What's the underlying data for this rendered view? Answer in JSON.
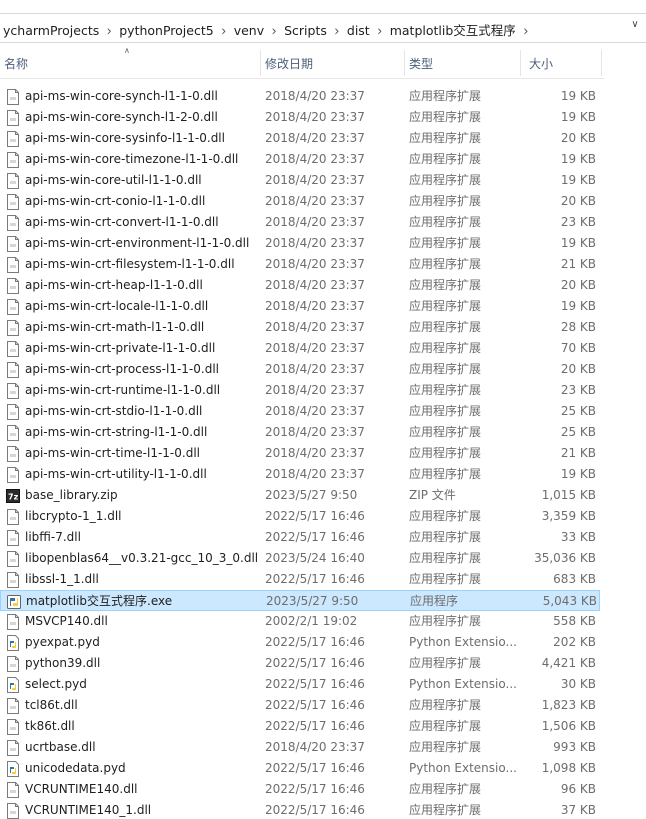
{
  "breadcrumb": [
    "ycharmProjects",
    "pythonProject5",
    "venv",
    "Scripts",
    "dist",
    "matplotlib交互式程序"
  ],
  "header": {
    "name": "名称",
    "date": "修改日期",
    "type": "类型",
    "size": "大小"
  },
  "rows": [
    {
      "name": "api-ms-win-core-synch-l1-1-0.dll",
      "date": "2018/4/20 23:37",
      "type": "应用程序扩展",
      "size": "19 KB",
      "icon": "dll-icon"
    },
    {
      "name": "api-ms-win-core-synch-l1-2-0.dll",
      "date": "2018/4/20 23:37",
      "type": "应用程序扩展",
      "size": "19 KB",
      "icon": "dll-icon"
    },
    {
      "name": "api-ms-win-core-sysinfo-l1-1-0.dll",
      "date": "2018/4/20 23:37",
      "type": "应用程序扩展",
      "size": "20 KB",
      "icon": "dll-icon"
    },
    {
      "name": "api-ms-win-core-timezone-l1-1-0.dll",
      "date": "2018/4/20 23:37",
      "type": "应用程序扩展",
      "size": "19 KB",
      "icon": "dll-icon"
    },
    {
      "name": "api-ms-win-core-util-l1-1-0.dll",
      "date": "2018/4/20 23:37",
      "type": "应用程序扩展",
      "size": "19 KB",
      "icon": "dll-icon"
    },
    {
      "name": "api-ms-win-crt-conio-l1-1-0.dll",
      "date": "2018/4/20 23:37",
      "type": "应用程序扩展",
      "size": "20 KB",
      "icon": "dll-icon"
    },
    {
      "name": "api-ms-win-crt-convert-l1-1-0.dll",
      "date": "2018/4/20 23:37",
      "type": "应用程序扩展",
      "size": "23 KB",
      "icon": "dll-icon"
    },
    {
      "name": "api-ms-win-crt-environment-l1-1-0.dll",
      "date": "2018/4/20 23:37",
      "type": "应用程序扩展",
      "size": "19 KB",
      "icon": "dll-icon"
    },
    {
      "name": "api-ms-win-crt-filesystem-l1-1-0.dll",
      "date": "2018/4/20 23:37",
      "type": "应用程序扩展",
      "size": "21 KB",
      "icon": "dll-icon"
    },
    {
      "name": "api-ms-win-crt-heap-l1-1-0.dll",
      "date": "2018/4/20 23:37",
      "type": "应用程序扩展",
      "size": "20 KB",
      "icon": "dll-icon"
    },
    {
      "name": "api-ms-win-crt-locale-l1-1-0.dll",
      "date": "2018/4/20 23:37",
      "type": "应用程序扩展",
      "size": "19 KB",
      "icon": "dll-icon"
    },
    {
      "name": "api-ms-win-crt-math-l1-1-0.dll",
      "date": "2018/4/20 23:37",
      "type": "应用程序扩展",
      "size": "28 KB",
      "icon": "dll-icon"
    },
    {
      "name": "api-ms-win-crt-private-l1-1-0.dll",
      "date": "2018/4/20 23:37",
      "type": "应用程序扩展",
      "size": "70 KB",
      "icon": "dll-icon"
    },
    {
      "name": "api-ms-win-crt-process-l1-1-0.dll",
      "date": "2018/4/20 23:37",
      "type": "应用程序扩展",
      "size": "20 KB",
      "icon": "dll-icon"
    },
    {
      "name": "api-ms-win-crt-runtime-l1-1-0.dll",
      "date": "2018/4/20 23:37",
      "type": "应用程序扩展",
      "size": "23 KB",
      "icon": "dll-icon"
    },
    {
      "name": "api-ms-win-crt-stdio-l1-1-0.dll",
      "date": "2018/4/20 23:37",
      "type": "应用程序扩展",
      "size": "25 KB",
      "icon": "dll-icon"
    },
    {
      "name": "api-ms-win-crt-string-l1-1-0.dll",
      "date": "2018/4/20 23:37",
      "type": "应用程序扩展",
      "size": "25 KB",
      "icon": "dll-icon"
    },
    {
      "name": "api-ms-win-crt-time-l1-1-0.dll",
      "date": "2018/4/20 23:37",
      "type": "应用程序扩展",
      "size": "21 KB",
      "icon": "dll-icon"
    },
    {
      "name": "api-ms-win-crt-utility-l1-1-0.dll",
      "date": "2018/4/20 23:37",
      "type": "应用程序扩展",
      "size": "19 KB",
      "icon": "dll-icon"
    },
    {
      "name": "base_library.zip",
      "date": "2023/5/27 9:50",
      "type": "ZIP 文件",
      "size": "1,015 KB",
      "icon": "zip-icon"
    },
    {
      "name": "libcrypto-1_1.dll",
      "date": "2022/5/17 16:46",
      "type": "应用程序扩展",
      "size": "3,359 KB",
      "icon": "dll-icon"
    },
    {
      "name": "libffi-7.dll",
      "date": "2022/5/17 16:46",
      "type": "应用程序扩展",
      "size": "33 KB",
      "icon": "dll-icon"
    },
    {
      "name": "libopenblas64__v0.3.21-gcc_10_3_0.dll",
      "date": "2023/5/24 16:40",
      "type": "应用程序扩展",
      "size": "35,036 KB",
      "icon": "dll-icon"
    },
    {
      "name": "libssl-1_1.dll",
      "date": "2022/5/17 16:46",
      "type": "应用程序扩展",
      "size": "683 KB",
      "icon": "dll-icon"
    },
    {
      "name": "matplotlib交互式程序.exe",
      "date": "2023/5/27 9:50",
      "type": "应用程序",
      "size": "5,043 KB",
      "icon": "python-exe-icon",
      "selected": true
    },
    {
      "name": "MSVCP140.dll",
      "date": "2002/2/1 19:02",
      "type": "应用程序扩展",
      "size": "558 KB",
      "icon": "dll-icon"
    },
    {
      "name": "pyexpat.pyd",
      "date": "2022/5/17 16:46",
      "type": "Python Extensio...",
      "size": "202 KB",
      "icon": "pyd-icon"
    },
    {
      "name": "python39.dll",
      "date": "2022/5/17 16:46",
      "type": "应用程序扩展",
      "size": "4,421 KB",
      "icon": "dll-icon"
    },
    {
      "name": "select.pyd",
      "date": "2022/5/17 16:46",
      "type": "Python Extensio...",
      "size": "30 KB",
      "icon": "pyd-icon"
    },
    {
      "name": "tcl86t.dll",
      "date": "2022/5/17 16:46",
      "type": "应用程序扩展",
      "size": "1,823 KB",
      "icon": "dll-icon"
    },
    {
      "name": "tk86t.dll",
      "date": "2022/5/17 16:46",
      "type": "应用程序扩展",
      "size": "1,506 KB",
      "icon": "dll-icon"
    },
    {
      "name": "ucrtbase.dll",
      "date": "2018/4/20 23:37",
      "type": "应用程序扩展",
      "size": "993 KB",
      "icon": "dll-icon"
    },
    {
      "name": "unicodedata.pyd",
      "date": "2022/5/17 16:46",
      "type": "Python Extensio...",
      "size": "1,098 KB",
      "icon": "pyd-icon"
    },
    {
      "name": "VCRUNTIME140.dll",
      "date": "2022/5/17 16:46",
      "type": "应用程序扩展",
      "size": "96 KB",
      "icon": "dll-icon"
    },
    {
      "name": "VCRUNTIME140_1.dll",
      "date": "2022/5/17 16:46",
      "type": "应用程序扩展",
      "size": "37 KB",
      "icon": "dll-icon"
    }
  ]
}
